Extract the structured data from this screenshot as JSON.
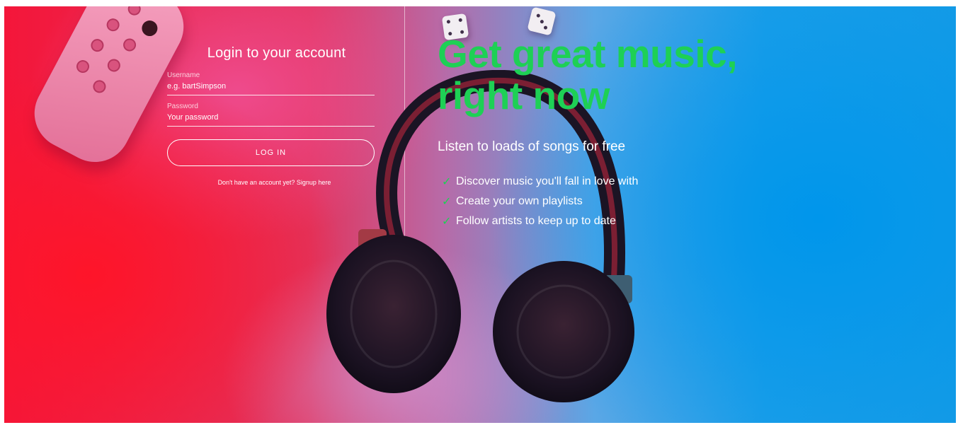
{
  "login": {
    "title": "Login to your account",
    "username_label": "Username",
    "username_placeholder": "e.g. bartSimpson",
    "password_label": "Password",
    "password_placeholder": "Your password",
    "button_label": "LOG IN",
    "signup_prompt": "Don't have an account yet?",
    "signup_link": "Signup here"
  },
  "promo": {
    "headline_line1": "Get great music,",
    "headline_line2": "right now",
    "subheading": "Listen to loads of songs for free",
    "features": [
      {
        "label": "Discover music you'll fall in love with",
        "icon": "check-icon"
      },
      {
        "label": "Create your own playlists",
        "icon": "check-icon"
      },
      {
        "label": "Follow artists to keep up to date",
        "icon": "check-icon"
      }
    ]
  },
  "colors": {
    "accent": "#1ed055",
    "text": "#ffffff",
    "background_left": "#f4163a",
    "background_right": "#149be6"
  },
  "icons": {
    "background_image": "headphones-photo-background"
  }
}
